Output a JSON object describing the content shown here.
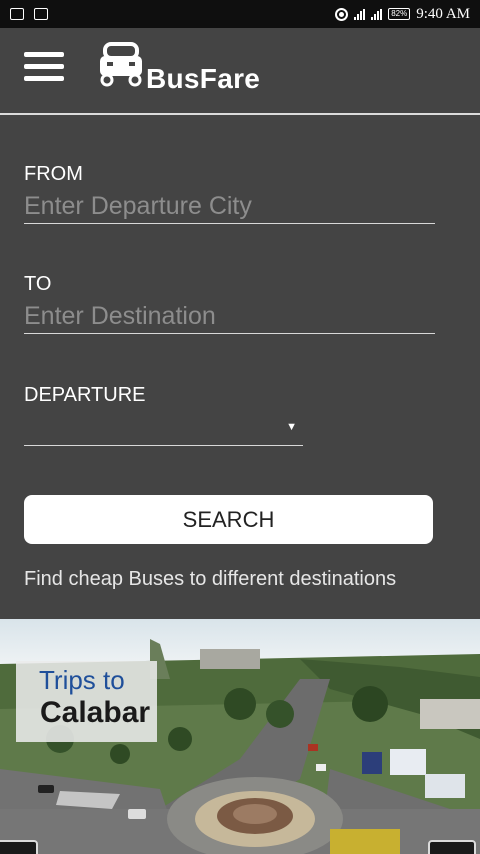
{
  "status_bar": {
    "time": "9:40 AM",
    "battery": "82%",
    "icons": [
      "message-icon",
      "image-icon",
      "hotspot-icon",
      "signal-icon",
      "signal-icon",
      "battery-icon"
    ]
  },
  "app": {
    "title": "BusFare",
    "menu_icon": "hamburger-menu-icon",
    "logo_icon": "car-icon"
  },
  "form": {
    "from_label": "FROM",
    "from_placeholder": "Enter Departure City",
    "to_label": "TO",
    "to_placeholder": "Enter Destination",
    "departure_label": "DEPARTURE",
    "departure_value": "",
    "search_label": "SEARCH"
  },
  "tagline": "Find cheap Buses to different destinations",
  "banner": {
    "line1": "Trips to",
    "line2": "Calabar"
  },
  "colors": {
    "background": "#444444",
    "status_bar": "#0f0f0f",
    "button": "#ffffff",
    "caption_accent": "#1f4f9a"
  }
}
